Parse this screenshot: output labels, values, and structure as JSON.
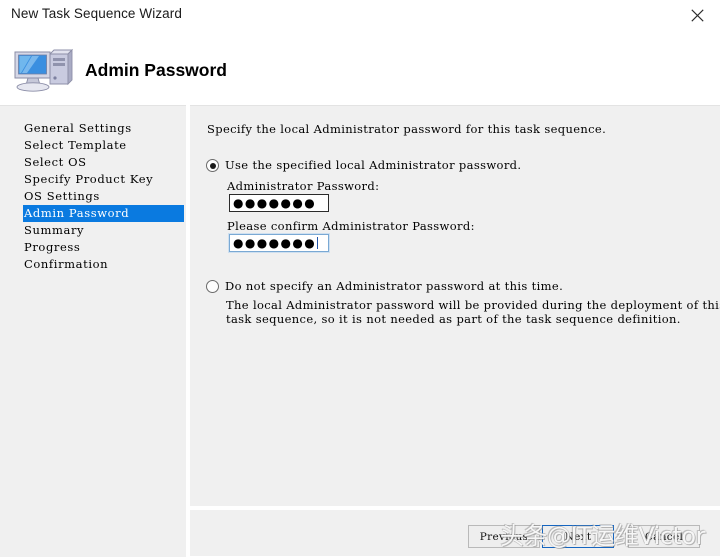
{
  "window": {
    "title": "New Task Sequence Wizard",
    "close_icon": "close-icon"
  },
  "header": {
    "title": "Admin Password",
    "icon": "computer-icon"
  },
  "sidebar": {
    "items": [
      {
        "label": "General Settings",
        "selected": false
      },
      {
        "label": "Select Template",
        "selected": false
      },
      {
        "label": "Select OS",
        "selected": false
      },
      {
        "label": "Specify Product Key",
        "selected": false
      },
      {
        "label": "OS Settings",
        "selected": false
      },
      {
        "label": "Admin Password",
        "selected": true
      },
      {
        "label": "Summary",
        "selected": false
      },
      {
        "label": "Progress",
        "selected": false
      },
      {
        "label": "Confirmation",
        "selected": false
      }
    ],
    "selected_bg": "#0a7ae0"
  },
  "content": {
    "intro": "Specify the local Administrator password for this task sequence.",
    "option_specified": {
      "label": "Use the specified local Administrator password.",
      "checked": true
    },
    "password_label": "Administrator Password:",
    "password_value": "●●●●●●●",
    "confirm_label": "Please confirm Administrator Password:",
    "confirm_value": "●●●●●●●",
    "option_donot": {
      "label": "Do not specify an Administrator password at this time.",
      "checked": false
    },
    "description_line1": "The local Administrator password will be provided during the deployment of this",
    "description_line2": "task sequence, so it is not needed as part of the task sequence definition."
  },
  "buttons": {
    "previous": "Previous",
    "next": "Next",
    "cancel": "Cancel"
  },
  "watermark": {
    "text": "头条@IT运维Victor"
  }
}
